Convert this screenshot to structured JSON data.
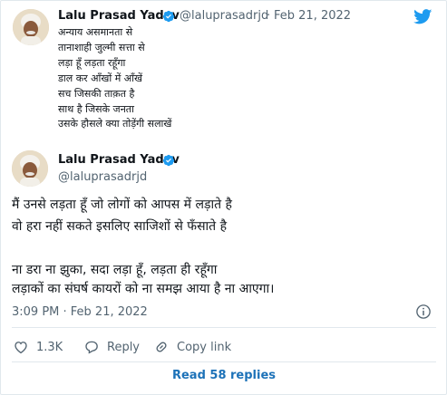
{
  "colors": {
    "twitter_blue": "#1d9bf0",
    "link_blue": "#1d72b8",
    "text": "#0f1419",
    "secondary": "#536471",
    "divider": "#e1e8ed"
  },
  "quoted_tweet": {
    "name": "Lalu Prasad Yadav",
    "handle": "@laluprasadrjd",
    "separator": "·",
    "date": "Feb 21, 2022",
    "lines": [
      "अन्याय असमानता से",
      "तानाशाही जुल्मी सत्ता से",
      "लड़ा हूँ लड़ता रहूँगा",
      "डाल कर आँखों में आँखें",
      "सच जिसकी ताक़त है",
      "साथ है जिसके जनता",
      "उसके हौसले क्या तोड़ेंगी सलाखें"
    ]
  },
  "tweet": {
    "name": "Lalu Prasad Yadav",
    "handle": "@laluprasadrjd",
    "lines": [
      "मैं उनसे लड़ता हूँ जो लोगों को आपस में लड़ाते है",
      "वो हरा नहीं सकते इसलिए साजिशों से फँसाते है",
      "",
      "ना डरा ना झुका, सदा लड़ा हूँ, लड़ता ही रहूँगा",
      "लड़ाकों का संघर्ष कायरों को ना समझ आया है ना आएगा।"
    ],
    "timestamp": "3:09 PM · Feb 21, 2022"
  },
  "actions": {
    "like_count": "1.3K",
    "reply_label": "Reply",
    "copy_label": "Copy link"
  },
  "footer": {
    "read_replies": "Read 58 replies"
  },
  "icons": [
    "twitter-logo-icon",
    "verified-badge-icon",
    "info-icon",
    "heart-icon",
    "reply-bubble-icon",
    "link-icon"
  ]
}
